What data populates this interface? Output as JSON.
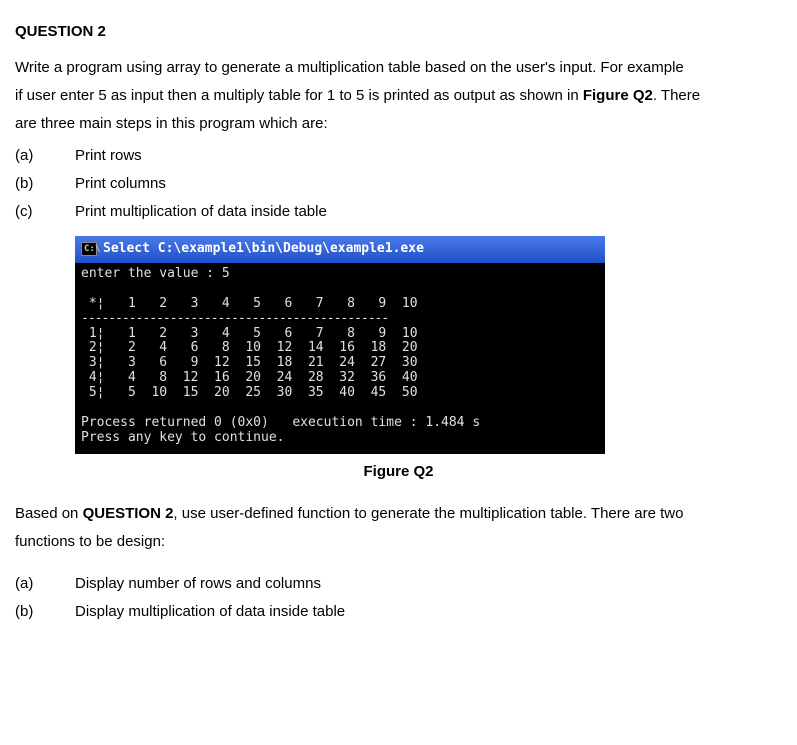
{
  "question": {
    "heading": "QUESTION 2",
    "intro_line1": "Write a program using array to generate a multiplication table based on the user's input. For example",
    "intro_line2_prefix": "if user enter 5 as input then a multiply table for 1 to 5 is printed as output as shown in ",
    "intro_line2_bold": "Figure Q2",
    "intro_line2_suffix": ". There",
    "intro_line3": "are three main steps in this program which are:",
    "steps": [
      {
        "label": "(a)",
        "text": "Print rows"
      },
      {
        "label": "(b)",
        "text": "Print columns"
      },
      {
        "label": "(c)",
        "text": "Print multiplication of data inside table"
      }
    ]
  },
  "console": {
    "icon_text": "C:\\",
    "title": "Select C:\\example1\\bin\\Debug\\example1.exe",
    "prompt": "enter the value : 5",
    "header_row": " *¦   1   2   3   4   5   6   7   8   9  10",
    "divider": "---------------------------------------------",
    "rows": [
      " 1¦   1   2   3   4   5   6   7   8   9  10",
      " 2¦   2   4   6   8  10  12  14  16  18  20",
      " 3¦   3   6   9  12  15  18  21  24  27  30",
      " 4¦   4   8  12  16  20  24  28  32  36  40",
      " 5¦   5  10  15  20  25  30  35  40  45  50"
    ],
    "footer1": "Process returned 0 (0x0)   execution time : 1.484 s",
    "footer2": "Press any key to continue."
  },
  "figure_caption": "Figure Q2",
  "followup": {
    "line1_prefix": "Based on ",
    "line1_bold": "QUESTION 2",
    "line1_suffix": ", use user-defined function to generate the multiplication table. There are two",
    "line2": "functions to be design:",
    "items": [
      {
        "label": "(a)",
        "text": "Display number of rows and columns"
      },
      {
        "label": "(b)",
        "text": "Display multiplication of data inside table"
      }
    ]
  },
  "chart_data": {
    "type": "table",
    "title": "Multiplication table (input 5, columns 1–10)",
    "columns": [
      1,
      2,
      3,
      4,
      5,
      6,
      7,
      8,
      9,
      10
    ],
    "rows": [
      1,
      2,
      3,
      4,
      5
    ],
    "values": [
      [
        1,
        2,
        3,
        4,
        5,
        6,
        7,
        8,
        9,
        10
      ],
      [
        2,
        4,
        6,
        8,
        10,
        12,
        14,
        16,
        18,
        20
      ],
      [
        3,
        6,
        9,
        12,
        15,
        18,
        21,
        24,
        27,
        30
      ],
      [
        4,
        8,
        12,
        16,
        20,
        24,
        28,
        32,
        36,
        40
      ],
      [
        5,
        10,
        15,
        20,
        25,
        30,
        35,
        40,
        45,
        50
      ]
    ],
    "process_return": 0,
    "execution_time_s": 1.484
  }
}
